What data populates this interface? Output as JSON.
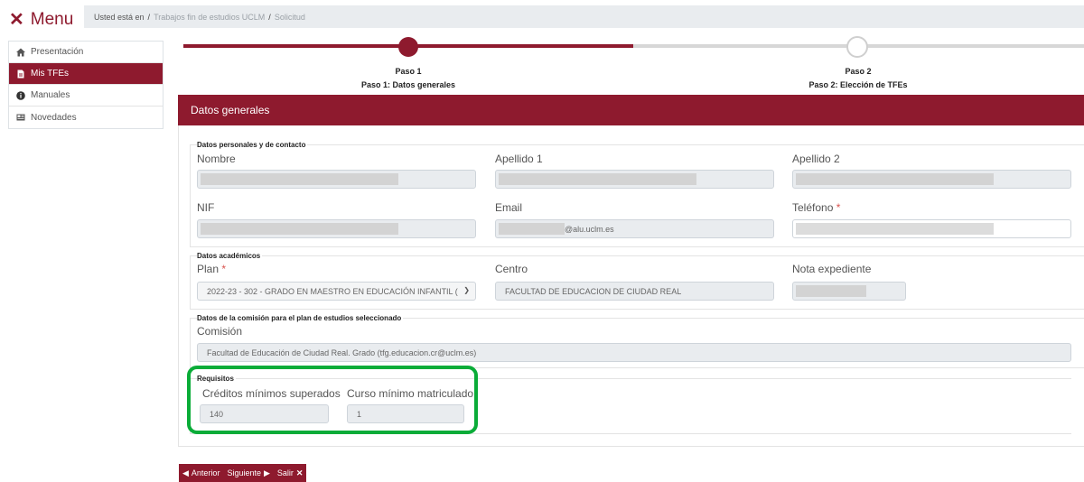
{
  "menu": {
    "icon": "close-icon",
    "label": "Menu"
  },
  "breadcrumb": {
    "prefix": "Usted está en",
    "sep": "/",
    "items": [
      "Trabajos fin de estudios UCLM",
      "Solicitud"
    ]
  },
  "sidebar": {
    "items": [
      {
        "icon": "home-icon",
        "label": "Presentación",
        "active": false
      },
      {
        "icon": "document-icon",
        "label": "Mis TFEs",
        "active": true
      },
      {
        "icon": "info-icon",
        "label": "Manuales",
        "active": false
      },
      {
        "icon": "newspaper-icon",
        "label": "Novedades",
        "active": false
      }
    ]
  },
  "steps": [
    {
      "label": "Paso 1",
      "title": "Paso 1: Datos generales",
      "status": "current"
    },
    {
      "label": "Paso 2",
      "title": "Paso 2: Elección de TFEs",
      "status": "pending"
    }
  ],
  "section": {
    "title": "Datos generales"
  },
  "personal": {
    "legend": "Datos personales y de contacto",
    "nombre_label": "Nombre",
    "apellido1_label": "Apellido 1",
    "apellido2_label": "Apellido 2",
    "nif_label": "NIF",
    "email_label": "Email",
    "email_value": "@alu.uclm.es",
    "telefono_label": "Teléfono",
    "required_mark": "*"
  },
  "academic": {
    "legend": "Datos académicos",
    "plan_label": "Plan",
    "plan_value": "2022-23 - 302 - GRADO EN MAESTRO EN EDUCACIÓN INFANTIL (",
    "centro_label": "Centro",
    "centro_value": "FACULTAD DE EDUCACION DE CIUDAD REAL",
    "nota_label": "Nota expediente"
  },
  "commission": {
    "legend": "Datos de la comisión para el plan de estudios seleccionado",
    "label": "Comisión",
    "value": "Facultad de Educación de Ciudad Real. Grado (tfg.educacion.cr@uclm.es)"
  },
  "requirements": {
    "legend": "Requisitos",
    "creditos_label": "Créditos mínimos superados",
    "creditos_value": "140",
    "curso_label": "Curso mínimo matriculado",
    "curso_value": "1"
  },
  "nav": {
    "prev": "Anterior",
    "next": "Siguiente",
    "exit": "Salir"
  },
  "colors": {
    "brand": "#8e1a2e",
    "highlight": "#0aac38"
  }
}
